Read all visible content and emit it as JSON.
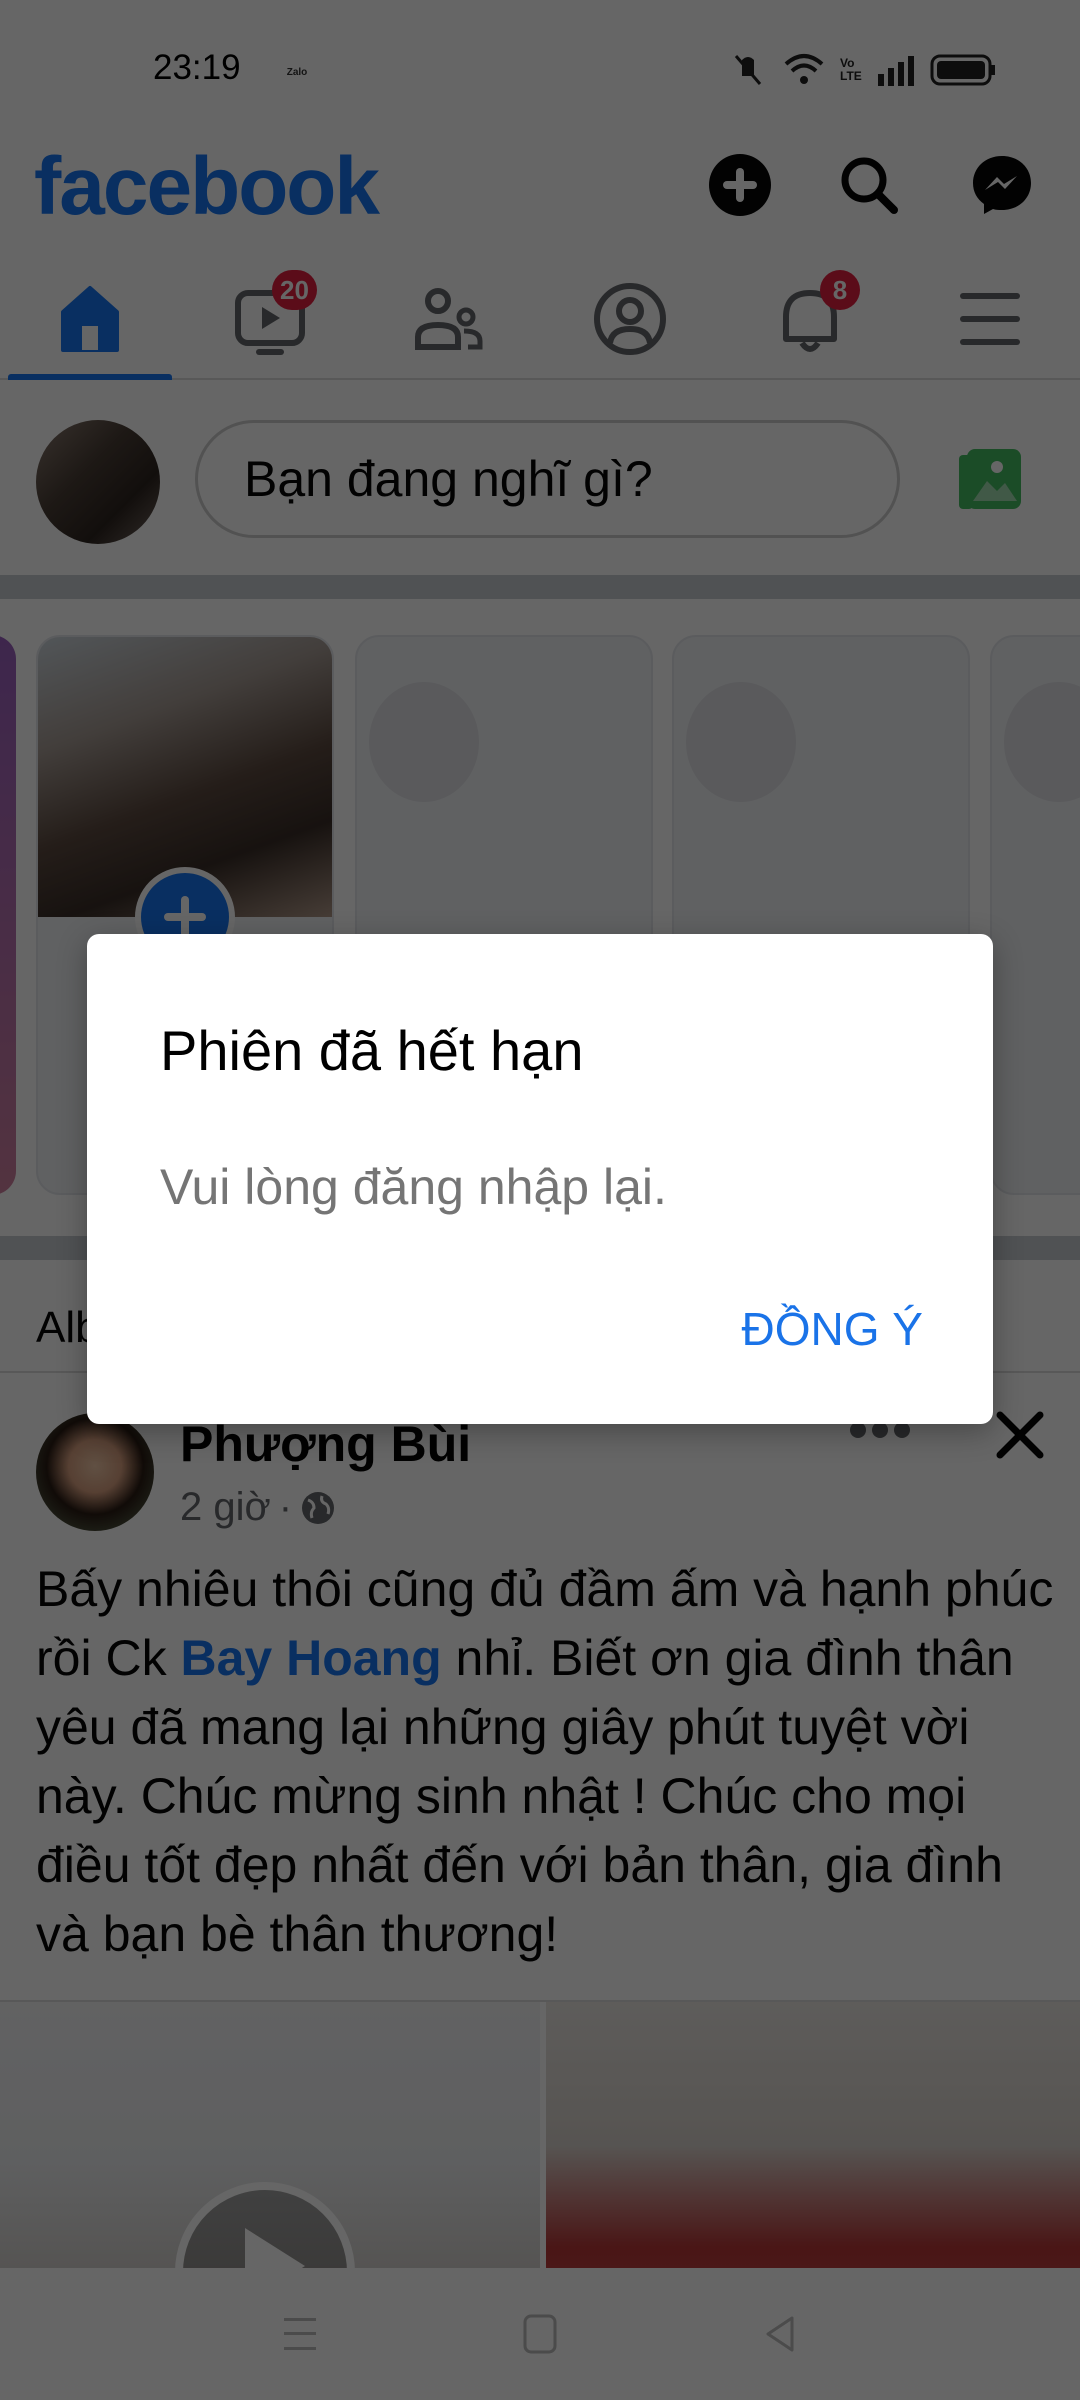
{
  "status_bar": {
    "time": "23:19",
    "notification_app": "Zalo",
    "icons": [
      "vibrate-mute-icon",
      "wifi-icon",
      "volte-icon",
      "signal-icon",
      "battery-icon"
    ],
    "volte_label": "Vo LTE"
  },
  "header": {
    "logo": "facebook",
    "actions": [
      {
        "name": "create-button",
        "icon": "plus-circle-icon"
      },
      {
        "name": "search-button",
        "icon": "search-icon"
      },
      {
        "name": "messenger-button",
        "icon": "messenger-icon"
      }
    ],
    "brand_color": "#1877f2"
  },
  "tabs": [
    {
      "name": "home",
      "icon": "home-icon",
      "active": true,
      "badge": null
    },
    {
      "name": "watch",
      "icon": "video-icon",
      "active": false,
      "badge": "20"
    },
    {
      "name": "friends",
      "icon": "friends-icon",
      "active": false,
      "badge": null
    },
    {
      "name": "profile",
      "icon": "profile-icon",
      "active": false,
      "badge": null
    },
    {
      "name": "notifications",
      "icon": "bell-icon",
      "active": false,
      "badge": "8"
    },
    {
      "name": "menu",
      "icon": "hamburger-icon",
      "active": false,
      "badge": null
    }
  ],
  "composer": {
    "placeholder": "Bạn đang nghĩ gì?"
  },
  "stories": {
    "create_icon": "plus-icon"
  },
  "album_label": "Alb",
  "post": {
    "author": "Phượng Bùi",
    "time": "2 giờ",
    "separator": "·",
    "privacy_icon": "globe-icon",
    "text_before": "Bấy nhiêu thôi cũng đủ đầm ấm và hạnh phúc rồi Ck ",
    "mention": "Bay Hoang",
    "text_after": " nhỉ. Biết ơn gia đình thân yêu đã mang lại những giây phút tuyệt vời này. Chúc mừng sinh nhật ! Chúc cho mọi điều tốt đẹp nhất đến với bản thân, gia đình và bạn bè thân thương!"
  },
  "dialog": {
    "title": "Phiên đã hết hạn",
    "message": "Vui lòng đăng nhập lại.",
    "ok_label": "ĐỒNG Ý",
    "ok_color": "#1a73e8"
  },
  "navbar": {
    "buttons": [
      "recents-icon",
      "home-icon",
      "back-icon"
    ]
  }
}
